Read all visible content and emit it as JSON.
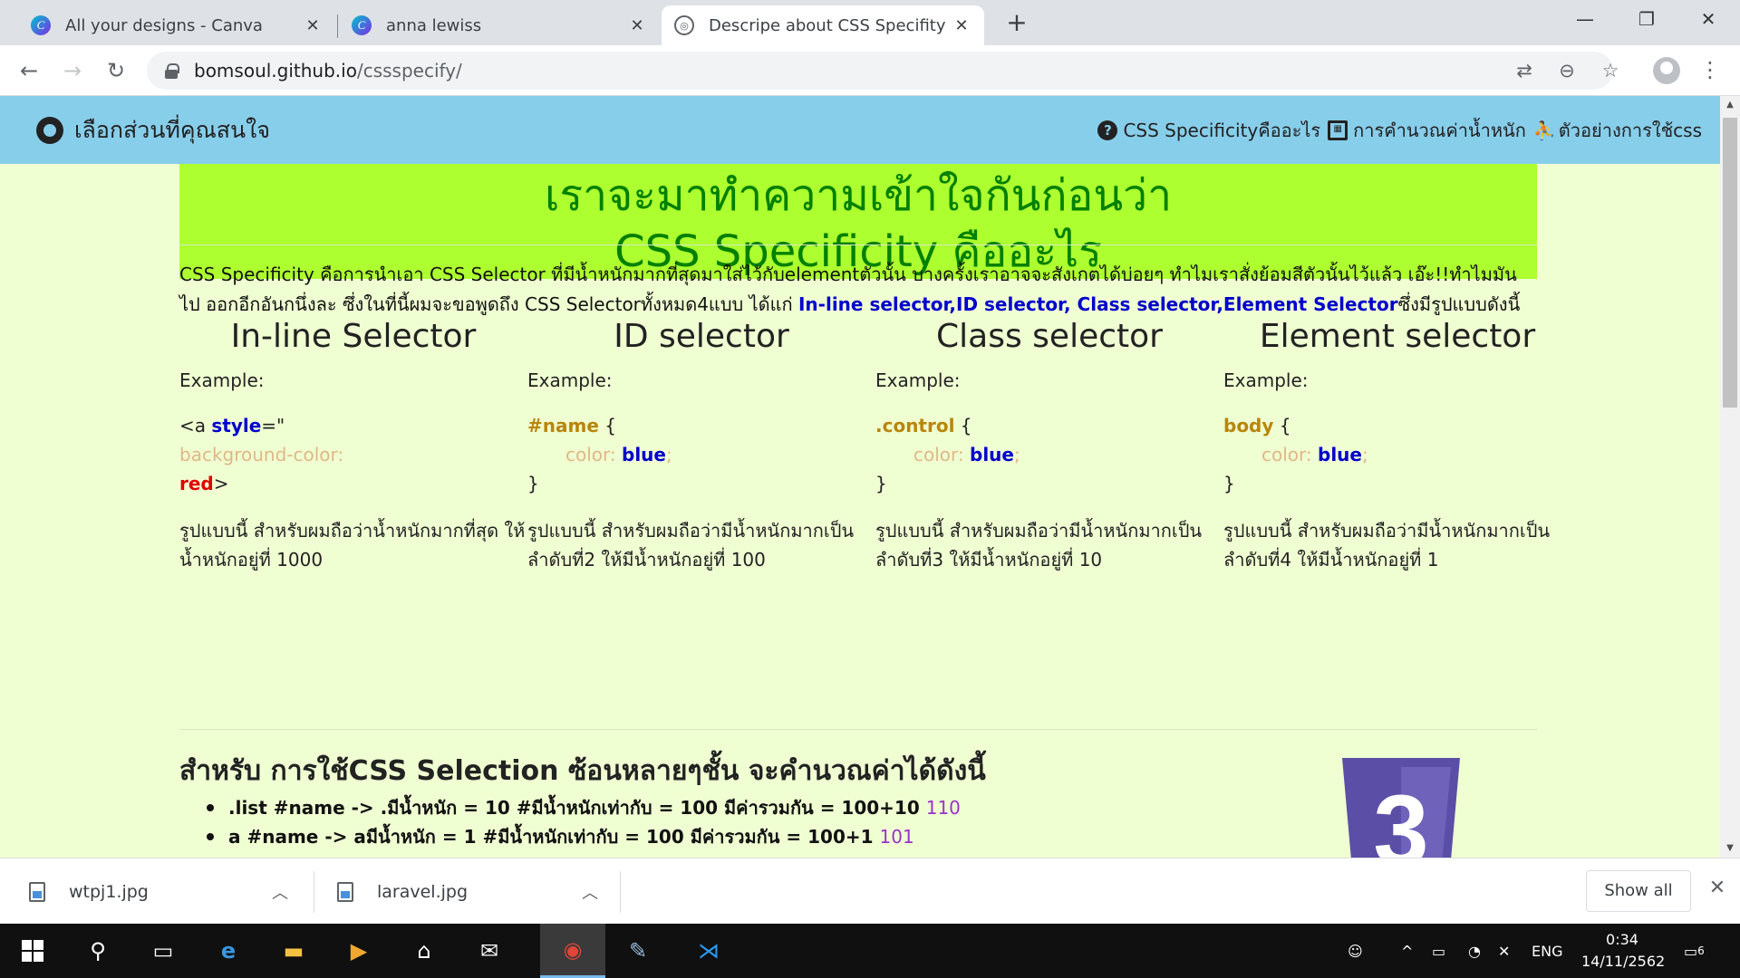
{
  "browser": {
    "tabs": [
      {
        "title": "All your designs - Canva",
        "favicon": "canva-icon"
      },
      {
        "title": "anna lewiss",
        "favicon": "canva-icon"
      },
      {
        "title": "Descripe about CSS Specifity",
        "favicon": "globe-icon"
      }
    ],
    "url_host": "bomsoul.github.io",
    "url_path": "/cssspecify/"
  },
  "site": {
    "brand": "เลือกส่วนที่คุณสนใจ",
    "nav": [
      {
        "label": "CSS Specificityคืออะไร",
        "icon": "question-circle-icon"
      },
      {
        "label": "การคำนวณค่าน้ำหนัก",
        "icon": "calculator-icon"
      },
      {
        "label": "ตัวอย่างการใช้css",
        "icon": "user-chalkboard-icon"
      }
    ],
    "hero_line1": "เราจะมาทำความเข้าใจกันก่อนว่า",
    "hero_line2": "CSS Specificity คืออะไร",
    "intro_text": "CSS Specificity คือการนำเอา CSS Selector ที่มีน้ำหนักมากที่สุดมาใส่ไว้กับelementตัวนั้น บางครั้งเราอาจจะสังเกตได้บ่อยๆ ทำไมเราสั่งย้อมสีตัวนั้นไว้แล้ว เอ๊ะ!!ทำไมมันไป ออกอีกอันกนึ่งละ ซึ่งในที่นี้ผมจะขอพูดถึง CSS Selectorทั้งหมด4แบบ ได้แก่ ",
    "intro_highlight": "In-line selector,ID selector, Class selector,Element Selector",
    "intro_tail": "ซึ่งมีรูปแบบดังนี้",
    "example_label": "Example:",
    "selectors": [
      {
        "title": "In-line Selector",
        "code_open": "<a ",
        "code_attr": "style",
        "code_eq": "=\"",
        "code_prop": "background-color:",
        "code_val": "red",
        "code_close": ">",
        "desc": "รูปแบบนี้ สำหรับผมถือว่าน้ำหนักมากที่สุด ให้น้ำหนักอยู่ที่ 1000"
      },
      {
        "title": "ID selector",
        "code_sel": "#name",
        "code_brace": " {",
        "code_prop": "color:",
        "code_val": "blue",
        "code_semi": ";",
        "code_end": "}",
        "desc": "รูปแบบนี้ สำหรับผมถือว่ามีน้ำหนักมากเป็นลำดับที่2 ให้มีน้ำหนักอยู่ที่ 100"
      },
      {
        "title": "Class selector",
        "code_sel": ".control",
        "code_brace": " {",
        "code_prop": "color:",
        "code_val": "blue",
        "code_semi": ";",
        "code_end": "}",
        "desc": "รูปแบบนี้ สำหรับผมถือว่ามีน้ำหนักมากเป็นลำดับที่3 ให้มีน้ำหนักอยู่ที่ 10"
      },
      {
        "title": "Element selector",
        "code_sel": "body",
        "code_brace": " {",
        "code_prop": "color:",
        "code_val": "blue",
        "code_semi": ";",
        "code_end": "}",
        "desc": "รูปแบบนี้ สำหรับผมถือว่ามีน้ำหนักมากเป็นลำดับที่4 ให้มีน้ำหนักอยู่ที่ 1"
      }
    ],
    "calc_title": "สำหรับ การใช้CSS Selection ซ้อนหลายๆชั้น จะคำนวณค่าได้ดังนี้",
    "calc_items": [
      {
        "text": ".list #name -> .มีน้ำหนัก = 10 #มีน้ำหนักเท่ากับ = 100 มีค่ารวมกัน = 100+10 ",
        "result": "110"
      },
      {
        "text": "a #name -> aมีน้ำหนัก = 1 #มีน้ำหนักเท่ากับ = 100 มีค่ารวมกัน = 100+1 ",
        "result": "101"
      }
    ],
    "css3_logo_number": "3"
  },
  "downloads": {
    "items": [
      {
        "name": "wtpj1.jpg"
      },
      {
        "name": "laravel.jpg"
      }
    ],
    "show_all": "Show all"
  },
  "taskbar": {
    "language": "ENG",
    "time": "0:34",
    "date": "14/11/2562",
    "notification_count": "6"
  },
  "colors": {
    "nav_bg": "#87ceeb",
    "hero_bg": "#adff2f",
    "hero_text": "#008000",
    "page_bg": "#f0ffd2",
    "highlight": "#0000cd",
    "result": "#9932cc",
    "css3": "#5b4ea6"
  }
}
